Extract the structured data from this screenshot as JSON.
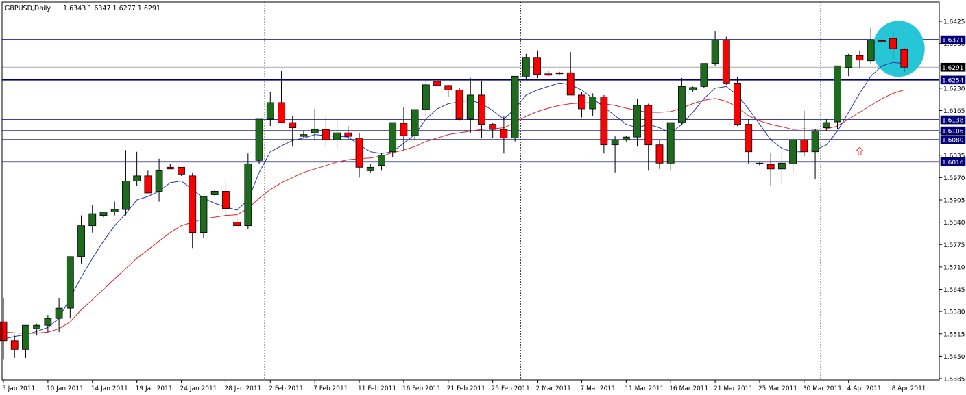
{
  "header": {
    "symbol": "GBPUSD,Daily",
    "ohlc": "1.6343 1.6347 1.6277 1.6291"
  },
  "colors": {
    "background": "#ffffff",
    "bull": "#1e6b1e",
    "bear": "#ff0000",
    "wick": "#000000",
    "ma_fast": "#2233aa",
    "ma_slow": "#dd2222",
    "hline": "#00007f",
    "current_line": "#aaaaaa",
    "highlight": "#26c6d6",
    "arrow": "#ee3333"
  },
  "chart_data": {
    "type": "candlestick",
    "title": "GBPUSD,Daily",
    "ylim": [
      1.5385,
      1.6425
    ],
    "y_ticks": [
      1.6425,
      1.636,
      1.6295,
      1.623,
      1.6165,
      1.61,
      1.6035,
      1.597,
      1.5905,
      1.584,
      1.5775,
      1.571,
      1.5645,
      1.558,
      1.5515,
      1.545,
      1.5385
    ],
    "x_labels": [
      {
        "i": 0,
        "label": "5 Jan 2011"
      },
      {
        "i": 4,
        "label": "10 Jan 2011"
      },
      {
        "i": 8,
        "label": "14 Jan 2011"
      },
      {
        "i": 12,
        "label": "19 Jan 2011"
      },
      {
        "i": 16,
        "label": "24 Jan 2011"
      },
      {
        "i": 20,
        "label": "28 Jan 2011"
      },
      {
        "i": 24,
        "label": "2 Feb 2011"
      },
      {
        "i": 28,
        "label": "7 Feb 2011"
      },
      {
        "i": 32,
        "label": "11 Feb 2011"
      },
      {
        "i": 36,
        "label": "16 Feb 2011"
      },
      {
        "i": 40,
        "label": "21 Feb 2011"
      },
      {
        "i": 44,
        "label": "25 Feb 2011"
      },
      {
        "i": 48,
        "label": "2 Mar 2011"
      },
      {
        "i": 52,
        "label": "7 Mar 2011"
      },
      {
        "i": 56,
        "label": "11 Mar 2011"
      },
      {
        "i": 60,
        "label": "16 Mar 2011"
      },
      {
        "i": 64,
        "label": "21 Mar 2011"
      },
      {
        "i": 68,
        "label": "25 Mar 2011"
      },
      {
        "i": 72,
        "label": "30 Mar 2011"
      },
      {
        "i": 76,
        "label": "4 Apr 2011"
      },
      {
        "i": 80,
        "label": "8 Apr 2011"
      }
    ],
    "period_separators": [
      23,
      46,
      73
    ],
    "candles": [
      {
        "o": 1.555,
        "h": 1.562,
        "l": 1.544,
        "c": 1.5495
      },
      {
        "o": 1.5495,
        "h": 1.551,
        "l": 1.5445,
        "c": 1.547
      },
      {
        "o": 1.547,
        "h": 1.554,
        "l": 1.5445,
        "c": 1.554
      },
      {
        "o": 1.553,
        "h": 1.5545,
        "l": 1.551,
        "c": 1.554
      },
      {
        "o": 1.554,
        "h": 1.557,
        "l": 1.552,
        "c": 1.556
      },
      {
        "o": 1.556,
        "h": 1.562,
        "l": 1.552,
        "c": 1.559
      },
      {
        "o": 1.559,
        "h": 1.574,
        "l": 1.556,
        "c": 1.574
      },
      {
        "o": 1.574,
        "h": 1.586,
        "l": 1.572,
        "c": 1.583
      },
      {
        "o": 1.583,
        "h": 1.589,
        "l": 1.581,
        "c": 1.5865
      },
      {
        "o": 1.586,
        "h": 1.587,
        "l": 1.5855,
        "c": 1.587
      },
      {
        "o": 1.587,
        "h": 1.59,
        "l": 1.586,
        "c": 1.5877
      },
      {
        "o": 1.5877,
        "h": 1.605,
        "l": 1.586,
        "c": 1.596
      },
      {
        "o": 1.596,
        "h": 1.6045,
        "l": 1.5945,
        "c": 1.5975
      },
      {
        "o": 1.5975,
        "h": 1.599,
        "l": 1.5925,
        "c": 1.5925
      },
      {
        "o": 1.593,
        "h": 1.6025,
        "l": 1.59,
        "c": 1.599
      },
      {
        "o": 1.6,
        "h": 1.601,
        "l": 1.5995,
        "c": 1.5995
      },
      {
        "o": 1.6,
        "h": 1.6,
        "l": 1.5975,
        "c": 1.598
      },
      {
        "o": 1.5975,
        "h": 1.5985,
        "l": 1.5765,
        "c": 1.581
      },
      {
        "o": 1.581,
        "h": 1.5915,
        "l": 1.5795,
        "c": 1.5915
      },
      {
        "o": 1.592,
        "h": 1.5935,
        "l": 1.5915,
        "c": 1.593
      },
      {
        "o": 1.593,
        "h": 1.596,
        "l": 1.5855,
        "c": 1.588
      },
      {
        "o": 1.584,
        "h": 1.585,
        "l": 1.5825,
        "c": 1.583
      },
      {
        "o": 1.583,
        "h": 1.604,
        "l": 1.582,
        "c": 1.601
      },
      {
        "o": 1.602,
        "h": 1.614,
        "l": 1.601,
        "c": 1.614
      },
      {
        "o": 1.614,
        "h": 1.622,
        "l": 1.612,
        "c": 1.6188
      },
      {
        "o": 1.6188,
        "h": 1.628,
        "l": 1.6135,
        "c": 1.613
      },
      {
        "o": 1.613,
        "h": 1.615,
        "l": 1.606,
        "c": 1.6115
      },
      {
        "o": 1.609,
        "h": 1.6105,
        "l": 1.6085,
        "c": 1.6095
      },
      {
        "o": 1.61,
        "h": 1.617,
        "l": 1.608,
        "c": 1.611
      },
      {
        "o": 1.611,
        "h": 1.615,
        "l": 1.606,
        "c": 1.608
      },
      {
        "o": 1.608,
        "h": 1.614,
        "l": 1.6055,
        "c": 1.61
      },
      {
        "o": 1.61,
        "h": 1.612,
        "l": 1.608,
        "c": 1.609
      },
      {
        "o": 1.6085,
        "h": 1.61,
        "l": 1.597,
        "c": 1.6
      },
      {
        "o": 1.599,
        "h": 1.601,
        "l": 1.5985,
        "c": 1.6
      },
      {
        "o": 1.6005,
        "h": 1.604,
        "l": 1.599,
        "c": 1.6035
      },
      {
        "o": 1.6045,
        "h": 1.613,
        "l": 1.603,
        "c": 1.613
      },
      {
        "o": 1.6128,
        "h": 1.6175,
        "l": 1.605,
        "c": 1.6092
      },
      {
        "o": 1.6092,
        "h": 1.6168,
        "l": 1.608,
        "c": 1.6168
      },
      {
        "o": 1.6168,
        "h": 1.6258,
        "l": 1.615,
        "c": 1.624
      },
      {
        "o": 1.625,
        "h": 1.6255,
        "l": 1.6235,
        "c": 1.6238
      },
      {
        "o": 1.6238,
        "h": 1.624,
        "l": 1.6205,
        "c": 1.6225
      },
      {
        "o": 1.6225,
        "h": 1.623,
        "l": 1.6135,
        "c": 1.614
      },
      {
        "o": 1.614,
        "h": 1.626,
        "l": 1.61,
        "c": 1.621
      },
      {
        "o": 1.621,
        "h": 1.625,
        "l": 1.6085,
        "c": 1.6125
      },
      {
        "o": 1.6125,
        "h": 1.613,
        "l": 1.6085,
        "c": 1.611
      },
      {
        "o": 1.611,
        "h": 1.615,
        "l": 1.604,
        "c": 1.6085
      },
      {
        "o": 1.6085,
        "h": 1.6265,
        "l": 1.6075,
        "c": 1.6265
      },
      {
        "o": 1.6265,
        "h": 1.633,
        "l": 1.6255,
        "c": 1.632
      },
      {
        "o": 1.632,
        "h": 1.634,
        "l": 1.626,
        "c": 1.627
      },
      {
        "o": 1.6272,
        "h": 1.628,
        "l": 1.6265,
        "c": 1.6268
      },
      {
        "o": 1.6275,
        "h": 1.6278,
        "l": 1.627,
        "c": 1.6272
      },
      {
        "o": 1.6275,
        "h": 1.6335,
        "l": 1.621,
        "c": 1.621
      },
      {
        "o": 1.621,
        "h": 1.622,
        "l": 1.6145,
        "c": 1.617
      },
      {
        "o": 1.617,
        "h": 1.6215,
        "l": 1.615,
        "c": 1.6205
      },
      {
        "o": 1.6205,
        "h": 1.621,
        "l": 1.604,
        "c": 1.6065
      },
      {
        "o": 1.6065,
        "h": 1.609,
        "l": 1.5985,
        "c": 1.608
      },
      {
        "o": 1.608,
        "h": 1.609,
        "l": 1.6075,
        "c": 1.6088
      },
      {
        "o": 1.6088,
        "h": 1.62,
        "l": 1.606,
        "c": 1.618
      },
      {
        "o": 1.618,
        "h": 1.6185,
        "l": 1.599,
        "c": 1.6065
      },
      {
        "o": 1.6065,
        "h": 1.608,
        "l": 1.5995,
        "c": 1.6012
      },
      {
        "o": 1.6012,
        "h": 1.613,
        "l": 1.599,
        "c": 1.613
      },
      {
        "o": 1.613,
        "h": 1.626,
        "l": 1.6125,
        "c": 1.6235
      },
      {
        "o": 1.6225,
        "h": 1.6235,
        "l": 1.622,
        "c": 1.6232
      },
      {
        "o": 1.6235,
        "h": 1.63,
        "l": 1.623,
        "c": 1.6302
      },
      {
        "o": 1.6302,
        "h": 1.6395,
        "l": 1.6295,
        "c": 1.637
      },
      {
        "o": 1.637,
        "h": 1.638,
        "l": 1.624,
        "c": 1.6245
      },
      {
        "o": 1.6245,
        "h": 1.6262,
        "l": 1.612,
        "c": 1.6125
      },
      {
        "o": 1.6125,
        "h": 1.614,
        "l": 1.601,
        "c": 1.6045
      },
      {
        "o": 1.601,
        "h": 1.6015,
        "l": 1.6005,
        "c": 1.6012
      },
      {
        "o": 1.6008,
        "h": 1.604,
        "l": 1.5945,
        "c": 1.5995
      },
      {
        "o": 1.5995,
        "h": 1.604,
        "l": 1.595,
        "c": 1.6012
      },
      {
        "o": 1.601,
        "h": 1.6085,
        "l": 1.5985,
        "c": 1.608
      },
      {
        "o": 1.608,
        "h": 1.6165,
        "l": 1.6032,
        "c": 1.6045
      },
      {
        "o": 1.6045,
        "h": 1.611,
        "l": 1.5965,
        "c": 1.6105
      },
      {
        "o": 1.6115,
        "h": 1.614,
        "l": 1.6105,
        "c": 1.613
      },
      {
        "o": 1.6132,
        "h": 1.6295,
        "l": 1.611,
        "c": 1.6295
      },
      {
        "o": 1.629,
        "h": 1.633,
        "l": 1.6265,
        "c": 1.6325
      },
      {
        "o": 1.6325,
        "h": 1.634,
        "l": 1.629,
        "c": 1.6312
      },
      {
        "o": 1.631,
        "h": 1.6405,
        "l": 1.6302,
        "c": 1.637
      },
      {
        "o": 1.6368,
        "h": 1.6375,
        "l": 1.636,
        "c": 1.6365
      },
      {
        "o": 1.6375,
        "h": 1.6395,
        "l": 1.6315,
        "c": 1.6345
      },
      {
        "o": 1.6343,
        "h": 1.6347,
        "l": 1.6277,
        "c": 1.6291
      }
    ],
    "ma_fast": [
      1.55,
      1.5507,
      1.5513,
      1.5522,
      1.5534,
      1.556,
      1.562,
      1.568,
      1.5735,
      1.5785,
      1.583,
      1.5865,
      1.5905,
      1.5915,
      1.593,
      1.5955,
      1.596,
      1.5935,
      1.591,
      1.5895,
      1.5885,
      1.5875,
      1.5905,
      1.5985,
      1.6045,
      1.6062,
      1.6078,
      1.6085,
      1.6095,
      1.6092,
      1.609,
      1.6088,
      1.6065,
      1.6045,
      1.604,
      1.6045,
      1.607,
      1.6095,
      1.614,
      1.617,
      1.6185,
      1.619,
      1.6195,
      1.6185,
      1.6165,
      1.614,
      1.617,
      1.621,
      1.6225,
      1.6235,
      1.6245,
      1.624,
      1.6225,
      1.62,
      1.6175,
      1.615,
      1.6125,
      1.6115,
      1.6125,
      1.6115,
      1.61,
      1.6125,
      1.616,
      1.62,
      1.623,
      1.6235,
      1.621,
      1.617,
      1.6125,
      1.608,
      1.6055,
      1.6045,
      1.6045,
      1.605,
      1.6065,
      1.6105,
      1.616,
      1.6215,
      1.6265,
      1.6295,
      1.6305,
      1.6302
    ],
    "ma_slow": [
      1.552,
      1.5518,
      1.5516,
      1.5517,
      1.552,
      1.553,
      1.555,
      1.5585,
      1.5615,
      1.5645,
      1.5675,
      1.5705,
      1.5735,
      1.576,
      1.5785,
      1.581,
      1.583,
      1.584,
      1.585,
      1.5855,
      1.586,
      1.5862,
      1.588,
      1.591,
      1.5935,
      1.5955,
      1.597,
      1.5985,
      1.5995,
      1.6005,
      1.6015,
      1.6022,
      1.6025,
      1.6027,
      1.6033,
      1.6042,
      1.605,
      1.606,
      1.6075,
      1.6085,
      1.6095,
      1.61,
      1.6105,
      1.611,
      1.6112,
      1.6115,
      1.613,
      1.6148,
      1.6162,
      1.6172,
      1.618,
      1.6185,
      1.6187,
      1.6188,
      1.6185,
      1.618,
      1.6172,
      1.6165,
      1.616,
      1.616,
      1.6162,
      1.6172,
      1.6185,
      1.6195,
      1.62,
      1.6192,
      1.6175,
      1.615,
      1.6135,
      1.6125,
      1.6118,
      1.611,
      1.6112,
      1.611,
      1.6112,
      1.612,
      1.614,
      1.616,
      1.618,
      1.62,
      1.6215,
      1.6225
    ]
  },
  "levels": [
    {
      "value": 1.6371,
      "label": "1.6371"
    },
    {
      "value": 1.6254,
      "label": "1.6254"
    },
    {
      "value": 1.6138,
      "label": "1.6138"
    },
    {
      "value": 1.6106,
      "label": "1.6106"
    },
    {
      "value": 1.608,
      "label": "1.6080"
    },
    {
      "value": 1.6016,
      "label": "1.6016"
    }
  ],
  "current_price": {
    "value": 1.6291,
    "label": "1.6291"
  },
  "annotations": {
    "arrow": {
      "index": 77,
      "price": 1.605
    },
    "highlight": {
      "from_index": 79,
      "to_index": 82,
      "price_low": 1.627,
      "price_high": 1.642
    }
  }
}
